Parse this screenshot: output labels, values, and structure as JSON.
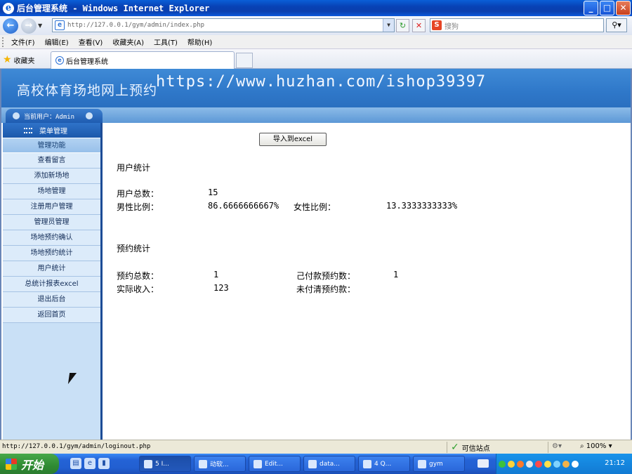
{
  "window": {
    "title": "后台管理系统 - Windows Internet Explorer",
    "buttons": {
      "minimize": "_",
      "maximize": "□",
      "close": "✕"
    }
  },
  "address_bar": {
    "url": "http://127.0.0.1/gym/admin/index.php",
    "search_placeholder": "搜狗"
  },
  "menu": [
    "文件(F)",
    "编辑(E)",
    "查看(V)",
    "收藏夹(A)",
    "工具(T)",
    "帮助(H)"
  ],
  "favorites": {
    "label": "收藏夹"
  },
  "tab": {
    "label": "后台管理系统"
  },
  "page": {
    "site_title": "高校体育场地网上预约",
    "watermark": "https://www.huzhan.com/ishop39397",
    "current_user": "当前用户：Admin",
    "sidebar": {
      "header": "菜单管理",
      "section": "管理功能",
      "items": [
        "查看留言",
        "添加新场地",
        "场地管理",
        "注册用户管理",
        "管理员管理",
        "场地预约确认",
        "场地预约统计",
        "用户统计",
        "总统计报表excel",
        "退出后台",
        "返回首页"
      ]
    },
    "export_button": "导入到excel",
    "user_stats": {
      "heading": "用户统计",
      "total_label": "用户总数：",
      "total_value": "15",
      "male_label": "男性比例：",
      "male_value": "86.6666666667%",
      "female_label": "女性比例：",
      "female_value": "13.3333333333%"
    },
    "booking_stats": {
      "heading": "预约统计",
      "total_label": "预约总数：",
      "total_value": "1",
      "paid_label": "己付款预约数：",
      "paid_value": "1",
      "income_label": "实际收入：",
      "income_value": "123",
      "unpaid_label": "未付清预约款："
    }
  },
  "status_bar": {
    "url": "http://127.0.0.1/gym/admin/loginout.php",
    "zone": "可信站点",
    "zoom": "100%"
  },
  "taskbar": {
    "start": "开始",
    "buttons": [
      "5 I...",
      "动软...",
      "Edit...",
      "data...",
      "4 Q...",
      "gym"
    ],
    "clock": "21:12"
  }
}
